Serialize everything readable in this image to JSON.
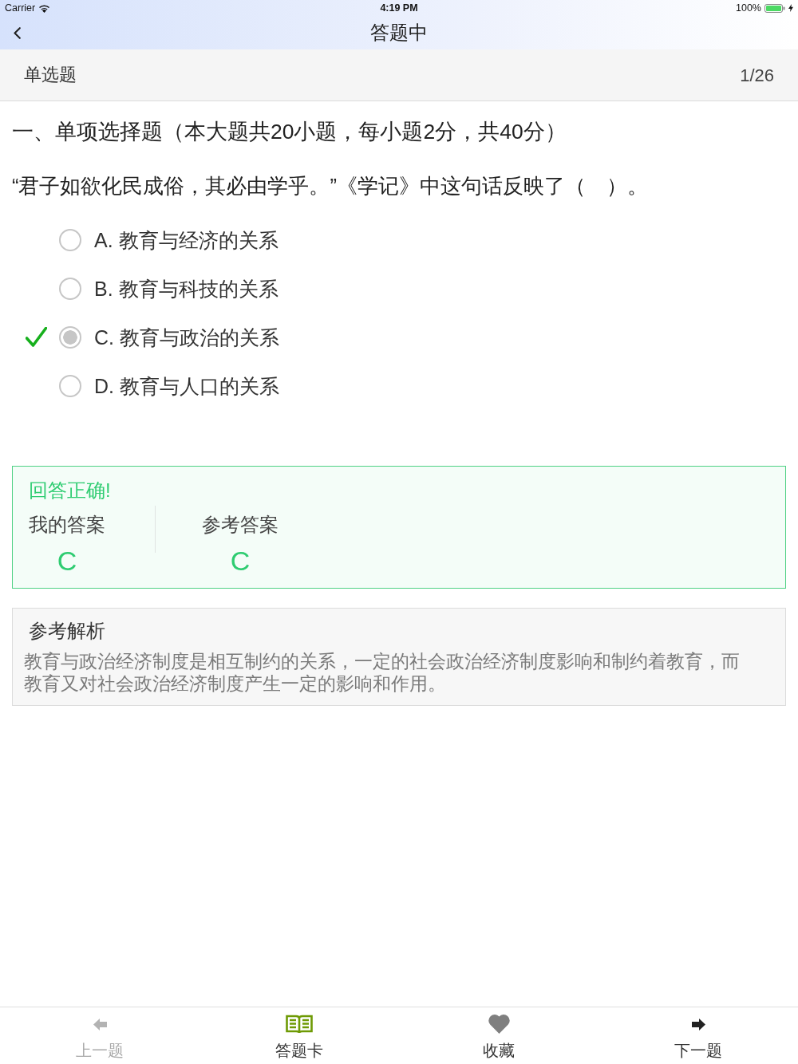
{
  "status_bar": {
    "carrier": "Carrier",
    "time": "4:19 PM",
    "battery": "100%"
  },
  "nav_bar": {
    "title": "答题中"
  },
  "type_bar": {
    "type": "单选题",
    "progress": "1/26"
  },
  "section_title": "一、单项选择题（本大题共20小题，每小题2分，共40分）",
  "question": "“君子如欲化民成俗，其必由学乎。”《学记》中这句话反映了（　）。",
  "options": [
    {
      "label": "A. 教育与经济的关系",
      "selected": false,
      "correct": false
    },
    {
      "label": "B. 教育与科技的关系",
      "selected": false,
      "correct": false
    },
    {
      "label": "C. 教育与政治的关系",
      "selected": true,
      "correct": true
    },
    {
      "label": "D. 教育与人口的关系",
      "selected": false,
      "correct": false
    }
  ],
  "result": {
    "title": "回答正确!",
    "correct": true,
    "answers": [
      {
        "label": "我的答案",
        "value": "C"
      },
      {
        "label": "参考答案",
        "value": "C"
      }
    ]
  },
  "analysis": {
    "title": "参考解析",
    "text": "教育与政治经济制度是相互制约的关系，一定的社会政治经济制度影响和制约着教育，而教育又对社会政治经济制度产生一定的影响和作用。"
  },
  "toolbar": [
    {
      "kind": "prev",
      "label": "上一题",
      "disabled": true
    },
    {
      "kind": "card",
      "label": "答题卡",
      "disabled": false
    },
    {
      "kind": "favorite",
      "label": "收藏",
      "disabled": false
    },
    {
      "kind": "next",
      "label": "下一题",
      "disabled": false
    }
  ]
}
